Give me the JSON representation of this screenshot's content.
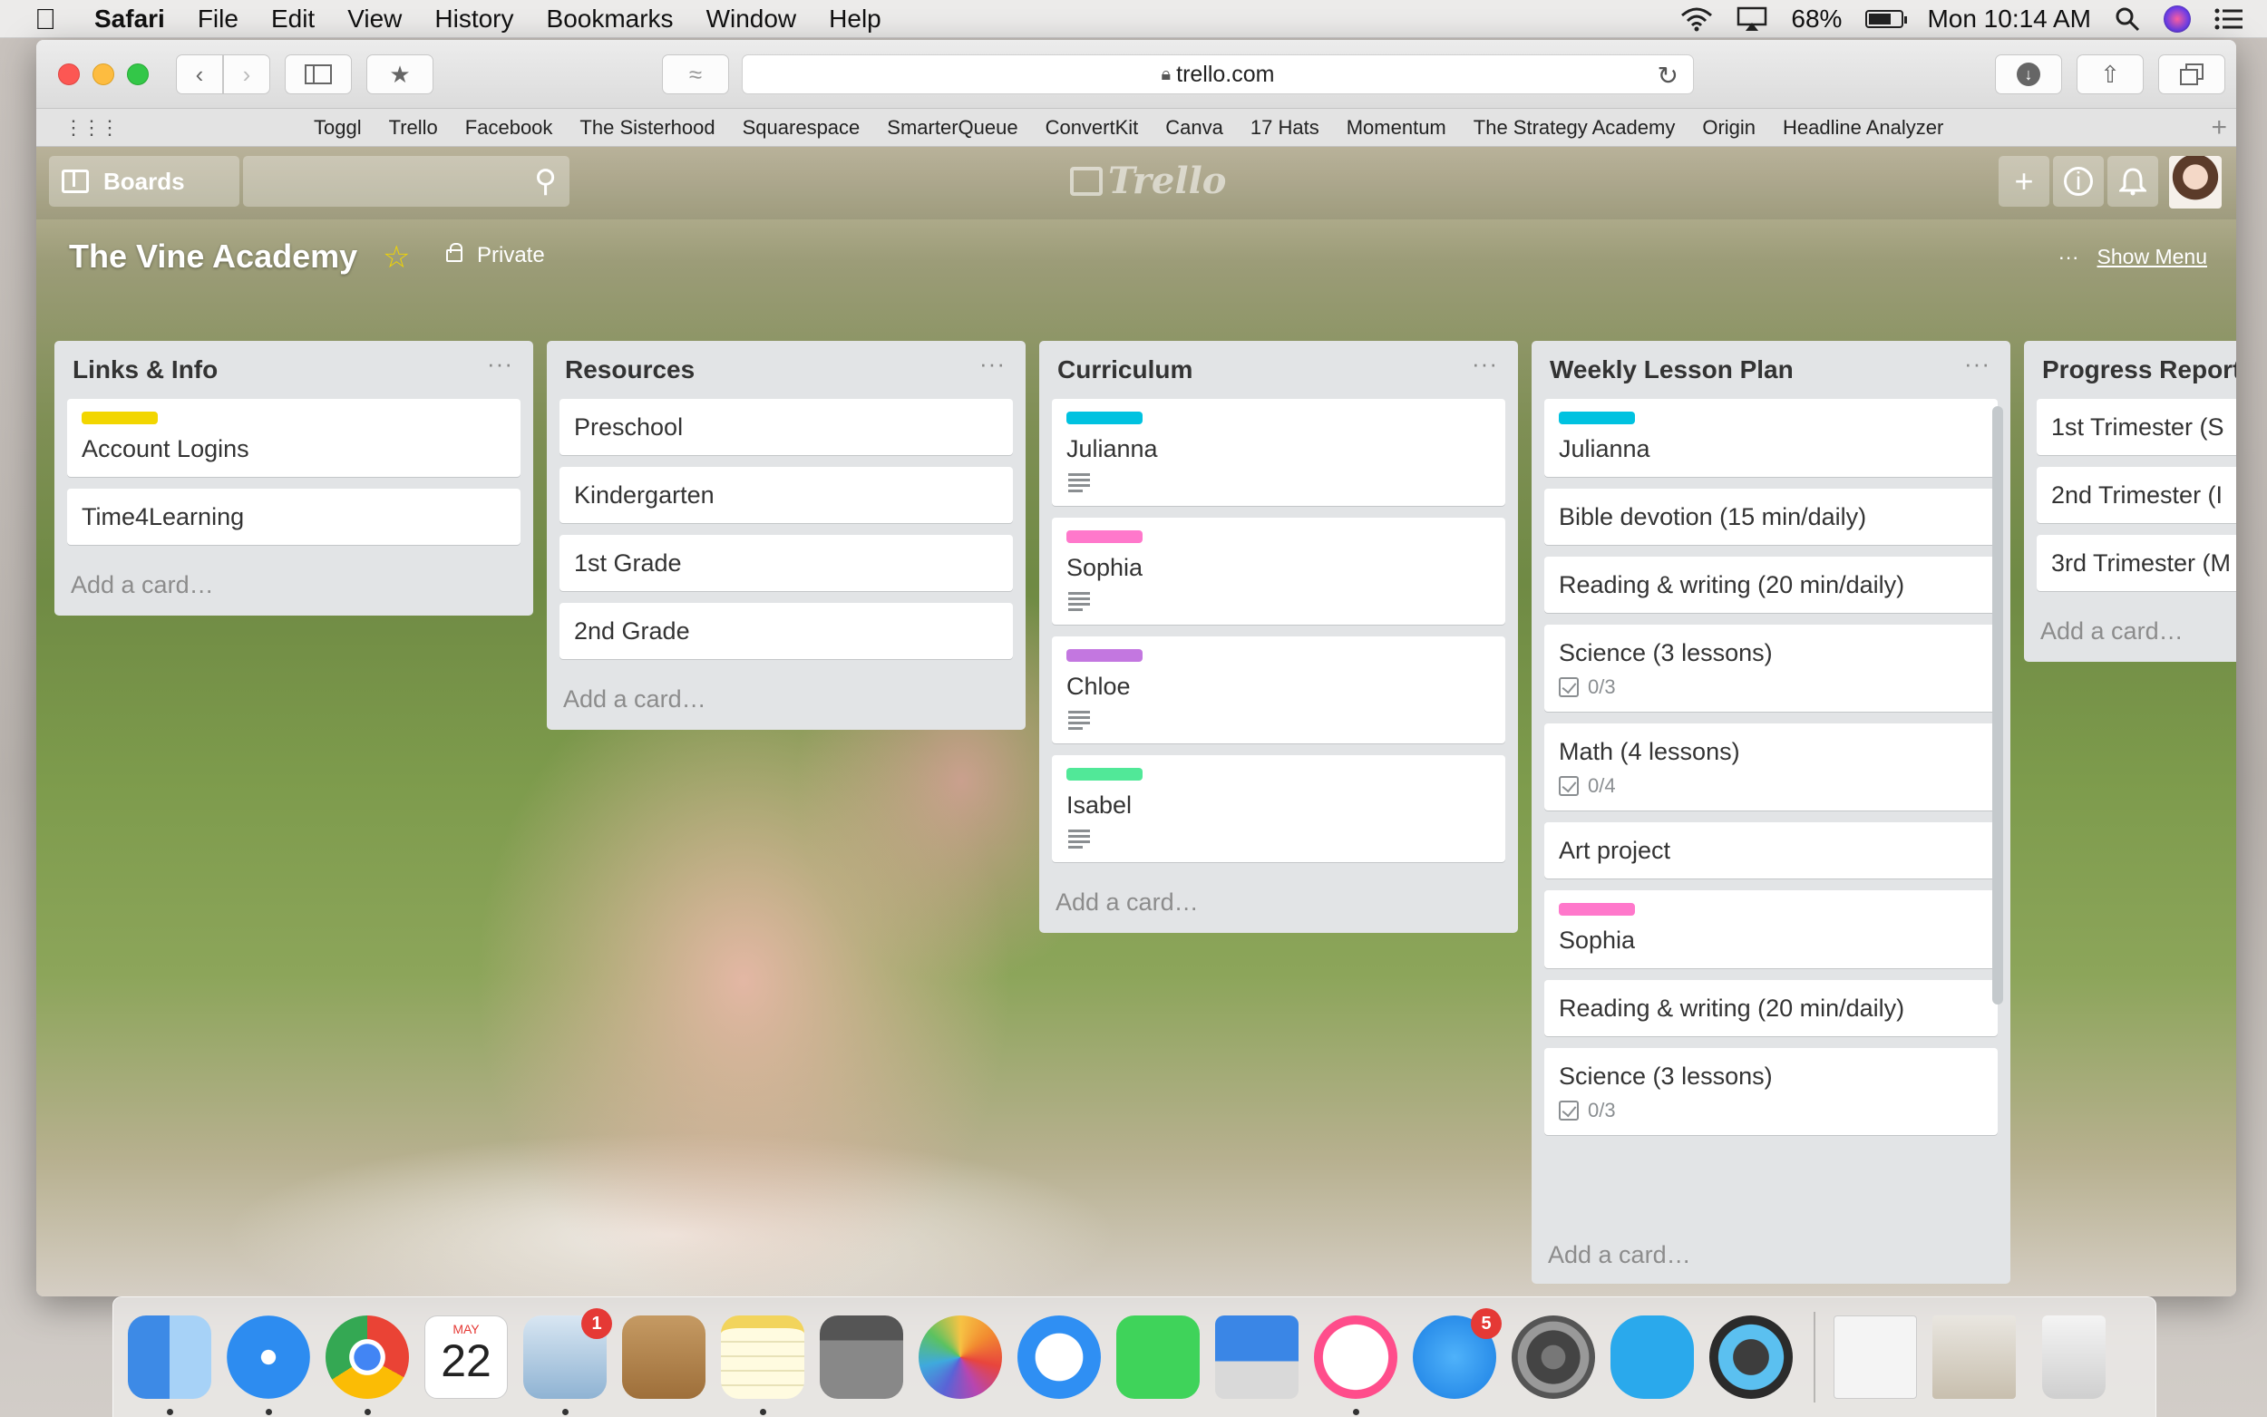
{
  "menubar": {
    "app": "Safari",
    "items": [
      "File",
      "Edit",
      "View",
      "History",
      "Bookmarks",
      "Window",
      "Help"
    ],
    "battery_percent": "68%",
    "battery_level": 0.68,
    "clock": "Mon 10:14 AM"
  },
  "browser": {
    "url": "trello.com",
    "bookmarks": [
      "Toggl",
      "Trello",
      "Facebook",
      "The Sisterhood",
      "Squarespace",
      "SmarterQueue",
      "ConvertKit",
      "Canva",
      "17 Hats",
      "Momentum",
      "The Strategy Academy",
      "Origin",
      "Headline Analyzer"
    ]
  },
  "trello": {
    "boards_label": "Boards",
    "logo": "Trello",
    "board_title": "The Vine Academy",
    "visibility": "Private",
    "show_menu": "Show Menu",
    "add_card": "Add a card…",
    "label_colors": {
      "yellow": "#f2d600",
      "blue": "#00c2e0",
      "pink": "#ff78cb",
      "purple": "#c377e0",
      "green": "#51e898"
    },
    "lists": [
      {
        "title": "Links & Info",
        "cards": [
          {
            "label": "yellow",
            "title": "Account Logins"
          },
          {
            "title": "Time4Learning"
          }
        ]
      },
      {
        "title": "Resources",
        "cards": [
          {
            "title": "Preschool"
          },
          {
            "title": "Kindergarten"
          },
          {
            "title": "1st Grade"
          },
          {
            "title": "2nd Grade"
          }
        ]
      },
      {
        "title": "Curriculum",
        "cards": [
          {
            "label": "blue",
            "title": "Julianna",
            "desc": true
          },
          {
            "label": "pink",
            "title": "Sophia",
            "desc": true
          },
          {
            "label": "purple",
            "title": "Chloe",
            "desc": true
          },
          {
            "label": "green",
            "title": "Isabel",
            "desc": true
          }
        ]
      },
      {
        "title": "Weekly Lesson Plan",
        "cards": [
          {
            "label": "blue",
            "title": "Julianna"
          },
          {
            "title": "Bible devotion (15 min/daily)"
          },
          {
            "title": "Reading & writing (20 min/daily)"
          },
          {
            "title": "Science (3 lessons)",
            "checklist": "0/3"
          },
          {
            "title": "Math (4 lessons)",
            "checklist": "0/4"
          },
          {
            "title": "Art project"
          },
          {
            "label": "pink",
            "title": "Sophia"
          },
          {
            "title": "Reading & writing (20 min/daily)"
          },
          {
            "title": "Science (3 lessons)",
            "checklist": "0/3"
          }
        ]
      },
      {
        "title": "Progress Report",
        "cards": [
          {
            "title": "1st Trimester (S"
          },
          {
            "title": "2nd Trimester (I"
          },
          {
            "title": "3rd Trimester (M"
          }
        ]
      }
    ]
  },
  "dock": {
    "calendar_month": "MAY",
    "calendar_day": "22",
    "mail_badge": "1",
    "appstore_badge": "5"
  }
}
